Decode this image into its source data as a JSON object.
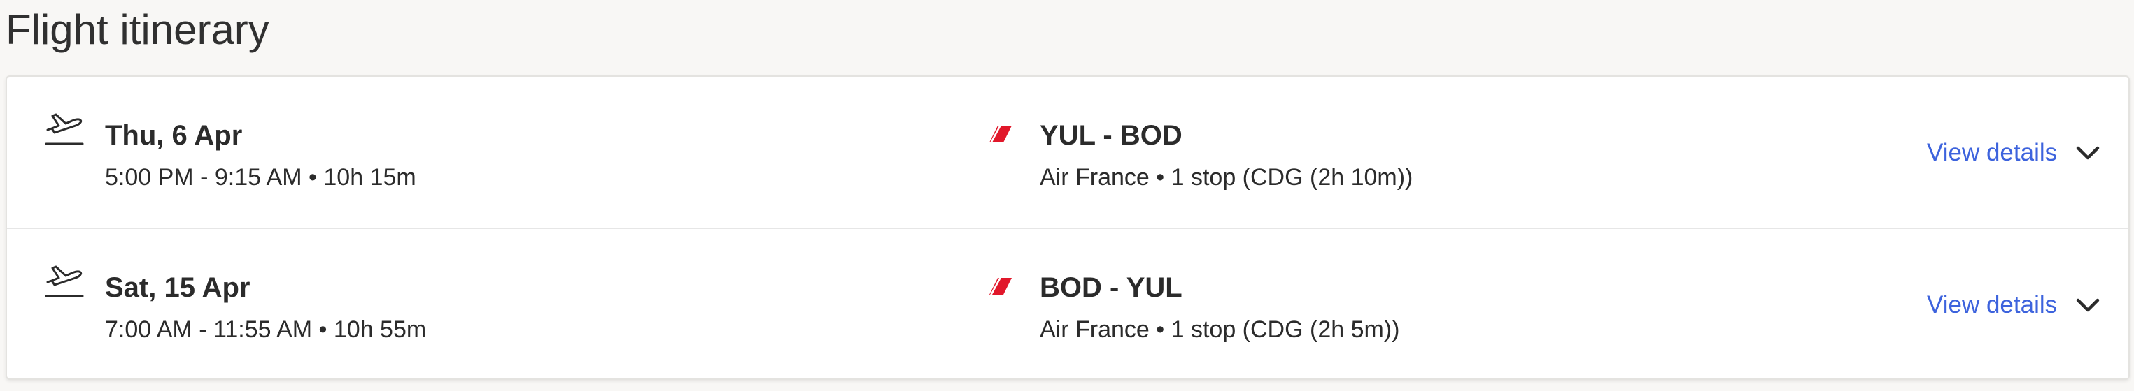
{
  "page": {
    "title": "Flight itinerary"
  },
  "legs": [
    {
      "icon": "plane-takeoff-icon",
      "date": "Thu, 6 Apr",
      "times": "5:00 PM - 9:15 AM • 10h 15m",
      "airline_icon": "air-france-logo-icon",
      "route": "YUL - BOD",
      "carrier": "Air France • 1 stop (CDG (2h 10m))",
      "details_label": "View details"
    },
    {
      "icon": "plane-takeoff-icon",
      "date": "Sat, 15 Apr",
      "times": "7:00 AM - 11:55 AM • 10h 55m",
      "airline_icon": "air-france-logo-icon",
      "route": "BOD - YUL",
      "carrier": "Air France • 1 stop (CDG (2h 5m))",
      "details_label": "View details"
    }
  ],
  "colors": {
    "link": "#3d63dd",
    "airline_brand": "#e1172a",
    "text": "#2b2b2b",
    "background": "#f8f7f5"
  }
}
